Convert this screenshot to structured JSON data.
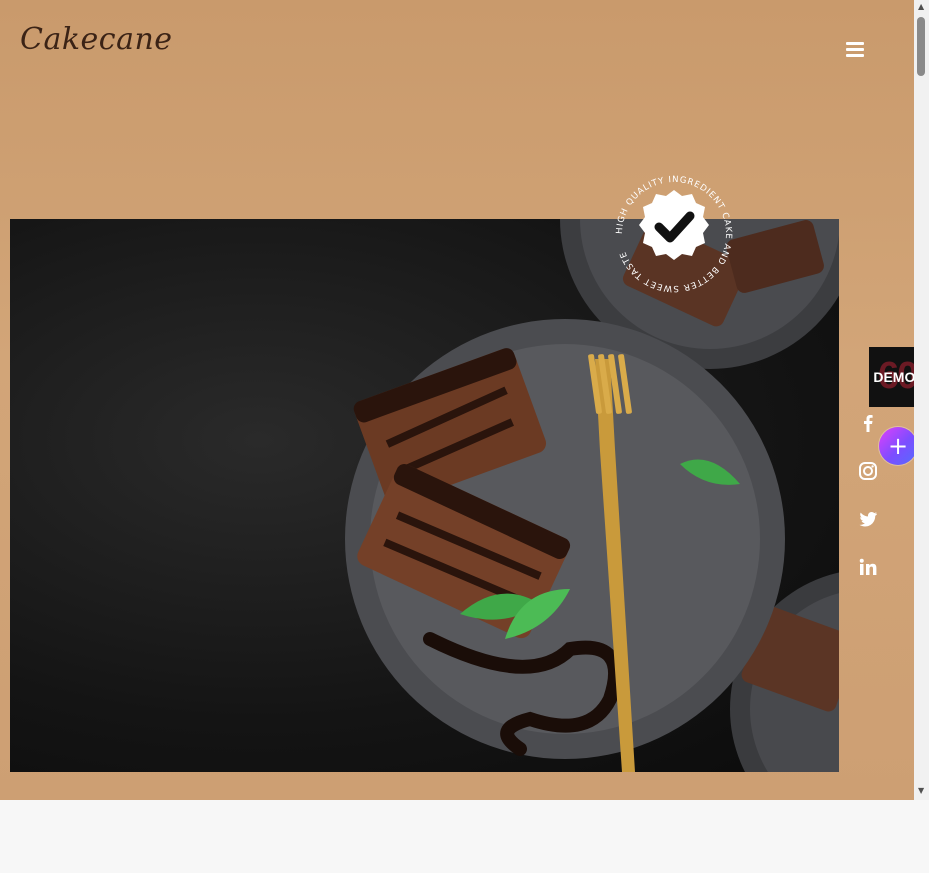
{
  "header": {
    "logo_text": "Cakecane",
    "menu_icon": "hamburger-menu-icon"
  },
  "badge": {
    "ring_text": "HIGH QUALITY INGREDIENT CAKE AND BETTER SWEET TASTE",
    "icon": "check-icon"
  },
  "hero": {
    "image": "chocolate-cake-slices-on-plate-with-fork-and-mint"
  },
  "side": {
    "demos_label": "DEMOS",
    "demos_bg_number": "60",
    "plus_label": "+"
  },
  "social": [
    "facebook-icon",
    "instagram-icon",
    "twitter-icon",
    "linkedin-icon"
  ],
  "colors": {
    "hero_bg": "#cd9f73",
    "logo": "#3b2316",
    "demos_bg": "#111111",
    "plus_gradient_start": "#e040fb",
    "plus_gradient_end": "#536dfe"
  }
}
